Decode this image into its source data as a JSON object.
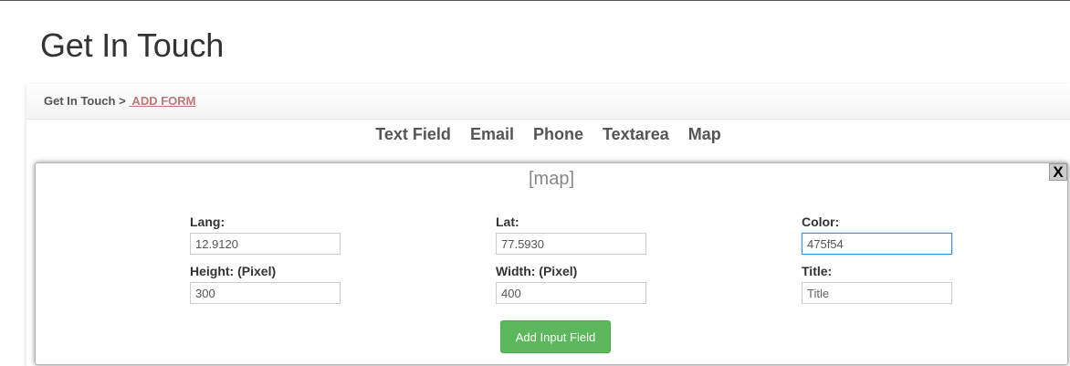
{
  "page": {
    "title": "Get In Touch"
  },
  "breadcrumb": {
    "root": "Get In Touch > ",
    "current": " ADD FORM"
  },
  "field_types": [
    "Text Field",
    "Email",
    "Phone",
    "Textarea",
    "Map"
  ],
  "map_box": {
    "heading": "[map]",
    "close_label": "X",
    "fields": {
      "lang": {
        "label": "Lang:",
        "value": "12.9120"
      },
      "lat": {
        "label": "Lat:",
        "value": "77.5930"
      },
      "color": {
        "label": "Color:",
        "value": "475f54"
      },
      "height": {
        "label": "Height: (Pixel)",
        "value": "300"
      },
      "width": {
        "label": "Width: (Pixel)",
        "value": "400"
      },
      "title": {
        "label": "Title:",
        "value": "",
        "placeholder": "Title"
      }
    },
    "add_button": "Add Input Field"
  },
  "colors": {
    "accent_green": "#5cb85c",
    "link": "#c0787a",
    "focus_border": "#3c8fd6"
  }
}
